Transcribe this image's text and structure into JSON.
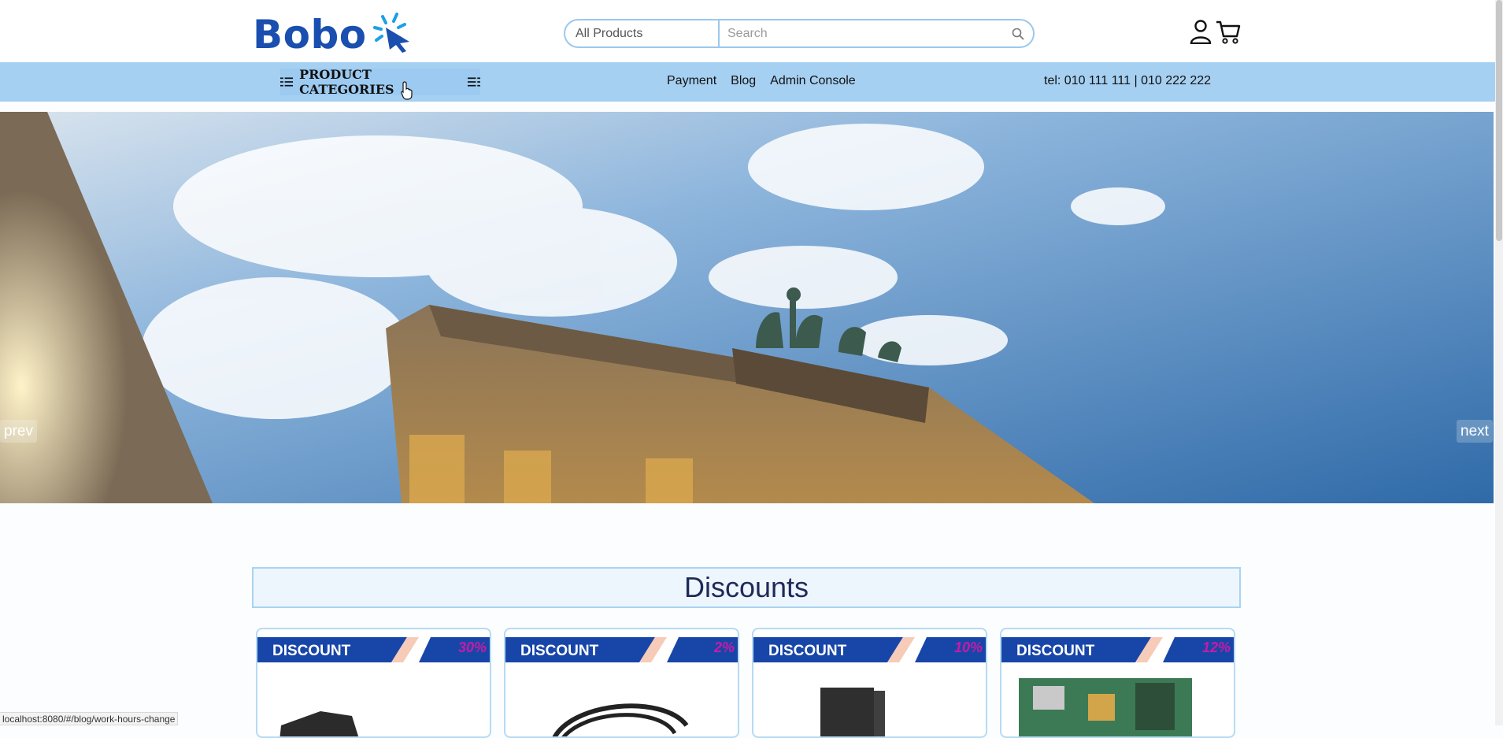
{
  "header": {
    "logo_text": "Bobo",
    "search": {
      "category_value": "All Products",
      "placeholder": "Search"
    },
    "icons": [
      "search-icon",
      "user-icon",
      "cart-icon",
      "cursor-star-icon"
    ]
  },
  "navbar": {
    "categories_label": "PRODUCT CATEGORIES",
    "links": [
      "Payment",
      "Blog",
      "Admin Console"
    ],
    "tel": "tel: 010 111 111 | 010 222 222"
  },
  "hero": {
    "prev_label": "prev",
    "next_label": "next"
  },
  "discounts": {
    "title": "Discounts",
    "cards": [
      {
        "label": "DISCOUNT",
        "percent": "30%"
      },
      {
        "label": "DISCOUNT",
        "percent": "2%"
      },
      {
        "label": "DISCOUNT",
        "percent": "10%"
      },
      {
        "label": "DISCOUNT",
        "percent": "12%"
      }
    ]
  },
  "status_bar": {
    "url": "localhost:8080/#/blog/work-hours-change"
  },
  "colors": {
    "brand": "#1a4fb0",
    "nav_bg": "#a6d0f2",
    "border_accent": "#9cc8ec",
    "badge_blue": "#1846a8",
    "badge_percent": "#c71aa5"
  }
}
